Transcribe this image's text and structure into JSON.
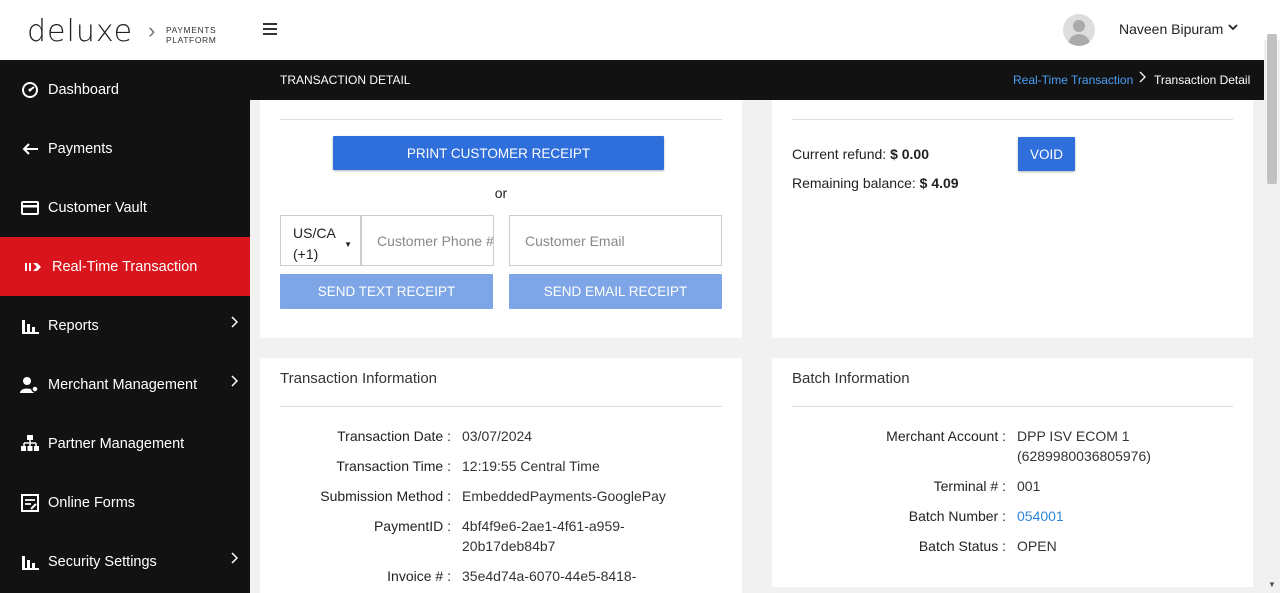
{
  "header": {
    "logo_text": "deluxe",
    "logo_sub_line1": "PAYMENTS",
    "logo_sub_line2": "PLATFORM",
    "user_name": "Naveen Bipuram"
  },
  "sidebar": {
    "items": [
      {
        "label": "Dashboard",
        "icon": "dashboard-icon",
        "active": false,
        "has_chevron": false
      },
      {
        "label": "Payments",
        "icon": "arrow-left-icon",
        "active": false,
        "has_chevron": false
      },
      {
        "label": "Customer Vault",
        "icon": "credit-card-icon",
        "active": false,
        "has_chevron": false
      },
      {
        "label": "Real-Time Transaction",
        "icon": "realtime-icon",
        "active": true,
        "has_chevron": false
      },
      {
        "label": "Reports",
        "icon": "bar-chart-icon",
        "active": false,
        "has_chevron": true
      },
      {
        "label": "Merchant Management",
        "icon": "user-gear-icon",
        "active": false,
        "has_chevron": true
      },
      {
        "label": "Partner Management",
        "icon": "hierarchy-icon",
        "active": false,
        "has_chevron": false
      },
      {
        "label": "Online Forms",
        "icon": "form-icon",
        "active": false,
        "has_chevron": false
      },
      {
        "label": "Security Settings",
        "icon": "bar-chart-icon",
        "active": false,
        "has_chevron": true
      }
    ]
  },
  "page": {
    "title": "TRANSACTION DETAIL",
    "breadcrumb_link": "Real-Time Transaction",
    "breadcrumb_current": "Transaction Detail"
  },
  "receipt": {
    "print_button": "PRINT CUSTOMER RECEIPT",
    "or_text": "or",
    "country_code_line1": "US/CA",
    "country_code_line2": "(+1)",
    "phone_placeholder": "Customer Phone #",
    "email_placeholder": "Customer Email",
    "send_text_button": "SEND TEXT RECEIPT",
    "send_email_button": "SEND EMAIL RECEIPT"
  },
  "refund": {
    "current_refund_label": "Current refund:",
    "current_refund_value": "$ 0.00",
    "remaining_label": "Remaining balance:",
    "remaining_value": "$ 4.09",
    "void_button": "VOID"
  },
  "transaction_info": {
    "title": "Transaction Information",
    "rows": [
      {
        "label": "Transaction Date :",
        "value": "03/07/2024"
      },
      {
        "label": "Transaction Time :",
        "value": "12:19:55 Central Time"
      },
      {
        "label": "Submission Method :",
        "value": "EmbeddedPayments-GooglePay"
      },
      {
        "label": "PaymentID :",
        "value_line1": "4bf4f9e6-2ae1-4f61-a959-",
        "value_line2": "20b17deb84b7"
      },
      {
        "label": "Invoice # :",
        "value_line1": "35e4d74a-6070-44e5-8418-"
      }
    ]
  },
  "batch_info": {
    "title": "Batch Information",
    "rows": [
      {
        "label": "Merchant Account :",
        "value_line1": "DPP ISV ECOM 1",
        "value_line2": "(6289980036805976)"
      },
      {
        "label": "Terminal # :",
        "value": "001"
      },
      {
        "label": "Batch Number :",
        "value": "054001"
      },
      {
        "label": "Batch Status :",
        "value": "OPEN"
      }
    ]
  }
}
